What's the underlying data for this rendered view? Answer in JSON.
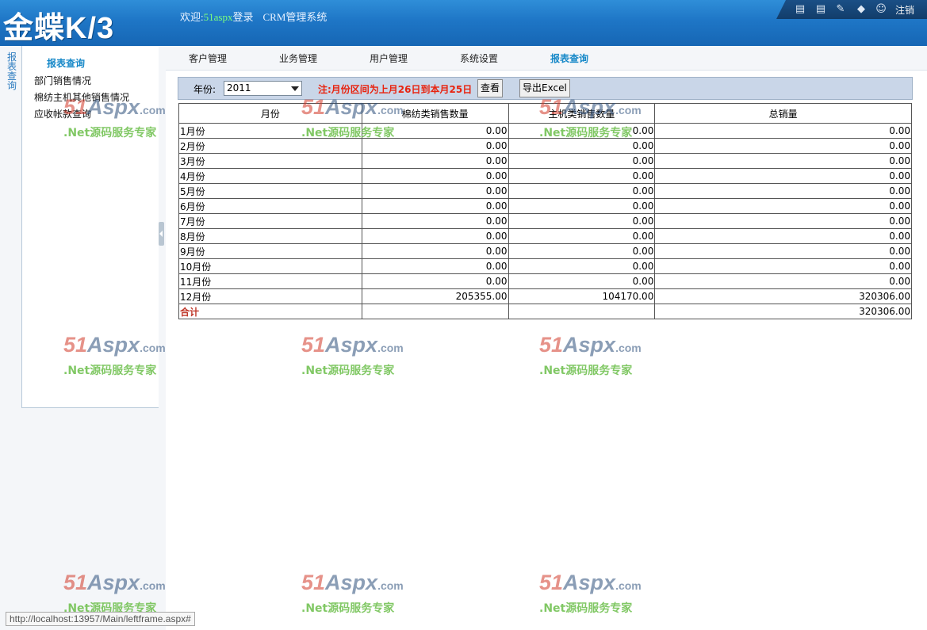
{
  "app": {
    "logo": "金蝶K/3",
    "welcome_prefix": "欢迎:",
    "username": "51aspx",
    "login_suffix": "登录",
    "system_name": "CRM管理系统",
    "logout_label": "注销",
    "toolbar_icons": [
      "panel-icon",
      "panel-icon-2",
      "note-icon",
      "info-icon",
      "user-key-icon"
    ]
  },
  "sidebar": {
    "vertical_tab": "报表查询",
    "heading": "报表查询",
    "items": [
      "部门销售情况",
      "棉纺主机其他销售情况",
      "应收帐款查询"
    ]
  },
  "nav": {
    "tabs": [
      "客户管理",
      "业务管理",
      "用户管理",
      "系统设置",
      "报表查询"
    ],
    "active_index": 4
  },
  "filter": {
    "year_label": "年份:",
    "year_value": "2011",
    "note": "注:月份区间为上月26日到本月25日",
    "query_button": "查看",
    "export_button": "导出Excel"
  },
  "table": {
    "headers": [
      "月份",
      "棉纺类销售数量",
      "主机类销售数量",
      "总销量"
    ],
    "rows": [
      [
        "1月份",
        "0.00",
        "0.00",
        "0.00"
      ],
      [
        "2月份",
        "0.00",
        "0.00",
        "0.00"
      ],
      [
        "3月份",
        "0.00",
        "0.00",
        "0.00"
      ],
      [
        "4月份",
        "0.00",
        "0.00",
        "0.00"
      ],
      [
        "5月份",
        "0.00",
        "0.00",
        "0.00"
      ],
      [
        "6月份",
        "0.00",
        "0.00",
        "0.00"
      ],
      [
        "7月份",
        "0.00",
        "0.00",
        "0.00"
      ],
      [
        "8月份",
        "0.00",
        "0.00",
        "0.00"
      ],
      [
        "9月份",
        "0.00",
        "0.00",
        "0.00"
      ],
      [
        "10月份",
        "0.00",
        "0.00",
        "0.00"
      ],
      [
        "11月份",
        "0.00",
        "0.00",
        "0.00"
      ],
      [
        "12月份",
        "205355.00",
        "104170.00",
        "320306.00"
      ]
    ],
    "total": [
      "合计",
      "",
      "",
      "320306.00"
    ]
  },
  "watermark": {
    "brand_51": "51",
    "brand_aspx": "Aspx",
    "brand_com": ".com",
    "slogan": ".Net源码服务专家"
  },
  "status_url": "http://localhost:13957/Main/leftframe.aspx#"
}
